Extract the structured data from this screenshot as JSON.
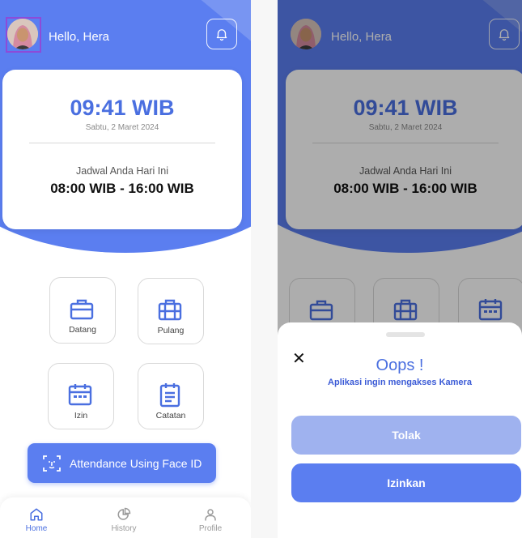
{
  "home": {
    "greeting": "Hello, Hera",
    "time": "09:41 WIB",
    "date": "Sabtu, 2 Maret 2024",
    "schedule_label": "Jadwal Anda Hari Ini",
    "schedule_time": "08:00 WIB -  16:00 WIB",
    "menu": [
      {
        "label": "Datang",
        "icon": "briefcase-icon"
      },
      {
        "label": "Pulang",
        "icon": "bag-icon"
      },
      {
        "label": "Izin",
        "icon": "calendar-icon"
      },
      {
        "label": "Catatan",
        "icon": "clipboard-icon"
      }
    ],
    "face_button": "Attendance Using Face ID",
    "nav": [
      {
        "label": "Home",
        "icon": "home-icon",
        "active": true
      },
      {
        "label": "History",
        "icon": "pie-chart-icon",
        "active": false
      },
      {
        "label": "Profile",
        "icon": "user-icon",
        "active": false
      }
    ]
  },
  "dialog": {
    "title": "Oops !",
    "message": "Aplikasi ingin mengakses Kamera",
    "reject_label": "Tolak",
    "allow_label": "Izinkan"
  },
  "colors": {
    "primary": "#5b7ef0",
    "primary_text": "#4a6fe0",
    "reject_bg": "#9fb2ef"
  }
}
